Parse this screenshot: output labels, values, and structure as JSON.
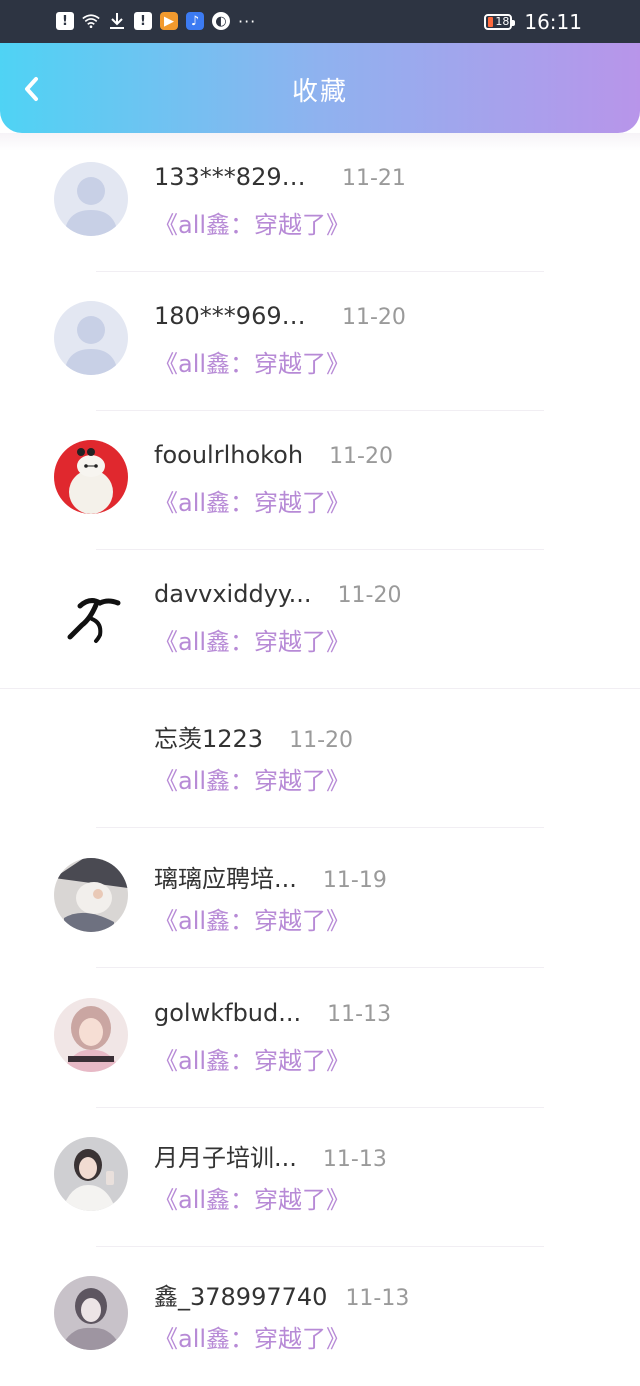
{
  "status_bar": {
    "time": "16:11",
    "battery": "18",
    "more": "···"
  },
  "header": {
    "title": "收藏"
  },
  "items": [
    {
      "name": "133***829_...",
      "date": "11-21",
      "book": "《all鑫：穿越了》",
      "avatar": "default-avatar"
    },
    {
      "name": "180***969_...",
      "date": "11-20",
      "book": "《all鑫：穿越了》",
      "avatar": "default-avatar"
    },
    {
      "name": "fooulrlhokoh",
      "date": "11-20",
      "book": "《all鑫：穿越了》",
      "avatar": "white-robot-avatar"
    },
    {
      "name": "davvxiddyy...",
      "date": "11-20",
      "book": "《all鑫：穿越了》",
      "avatar": "runner-avatar"
    },
    {
      "name": "忘羡1223",
      "date": "11-20",
      "book": "《all鑫：穿越了》",
      "avatar": "blank-avatar"
    },
    {
      "name": "璃璃应聘培...",
      "date": "11-19",
      "book": "《all鑫：穿越了》",
      "avatar": "photo-avatar"
    },
    {
      "name": "golwkfbud...",
      "date": "11-13",
      "book": "《all鑫：穿越了》",
      "avatar": "photo-avatar"
    },
    {
      "name": "月月子培训...",
      "date": "11-13",
      "book": "《all鑫：穿越了》",
      "avatar": "photo-avatar"
    },
    {
      "name": "鑫_378997740",
      "date": "11-13",
      "book": "《all鑫：穿越了》",
      "avatar": "photo-avatar"
    }
  ]
}
